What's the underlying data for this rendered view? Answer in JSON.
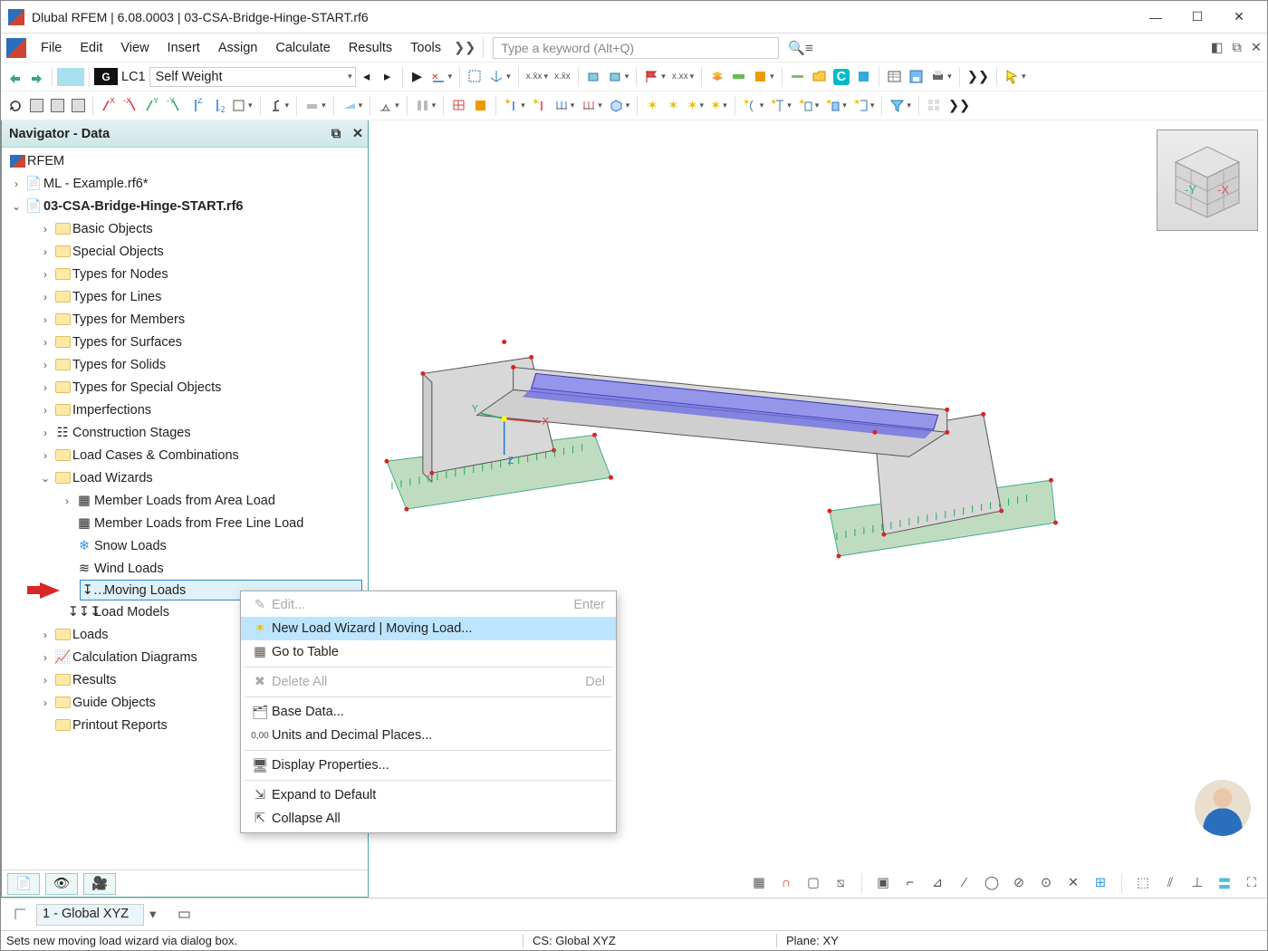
{
  "titlebar": {
    "title": "Dlubal RFEM | 6.08.0003 | 03-CSA-Bridge-Hinge-START.rf6"
  },
  "menubar": {
    "items": [
      "File",
      "Edit",
      "View",
      "Insert",
      "Assign",
      "Calculate",
      "Results",
      "Tools"
    ],
    "search_placeholder": "Type a keyword (Alt+Q)"
  },
  "quick": {
    "caseletter": "G",
    "casecode": "LC1",
    "casename": "Self Weight",
    "cs_label": "1 - Global XYZ"
  },
  "navigator": {
    "title": "Navigator - Data",
    "root": "RFEM",
    "files": [
      {
        "label": "ML - Example.rf6*",
        "expanded": false,
        "bold": false
      },
      {
        "label": "03-CSA-Bridge-Hinge-START.rf6",
        "expanded": true,
        "bold": true
      }
    ],
    "folders1": [
      "Basic Objects",
      "Special Objects",
      "Types for Nodes",
      "Types for Lines",
      "Types for Members",
      "Types for Surfaces",
      "Types for Solids",
      "Types for Special Objects",
      "Imperfections"
    ],
    "construction": "Construction Stages",
    "loadcomb": "Load Cases & Combinations",
    "loadwiz": "Load Wizards",
    "wizitems": [
      "Member Loads from Area Load",
      "Member Loads from Free Line Load",
      "Snow Loads",
      "Wind Loads",
      "Moving Loads",
      "Load Models"
    ],
    "folders2": [
      "Loads",
      "Calculation Diagrams",
      "Results",
      "Guide Objects",
      "Printout Reports"
    ]
  },
  "context": {
    "edit": "Edit...",
    "edit_hint": "Enter",
    "new": "New Load Wizard | Moving Load...",
    "goto": "Go to Table",
    "delall": "Delete All",
    "delall_hint": "Del",
    "base": "Base Data...",
    "units": "Units and Decimal Places...",
    "disp": "Display Properties...",
    "expand": "Expand to Default",
    "collapse": "Collapse All"
  },
  "status": {
    "hint": "Sets new moving load wizard via dialog box.",
    "cs": "CS: Global XYZ",
    "plane": "Plane: XY"
  },
  "orient": {
    "yneg": "-Y",
    "xneg": "-X"
  }
}
